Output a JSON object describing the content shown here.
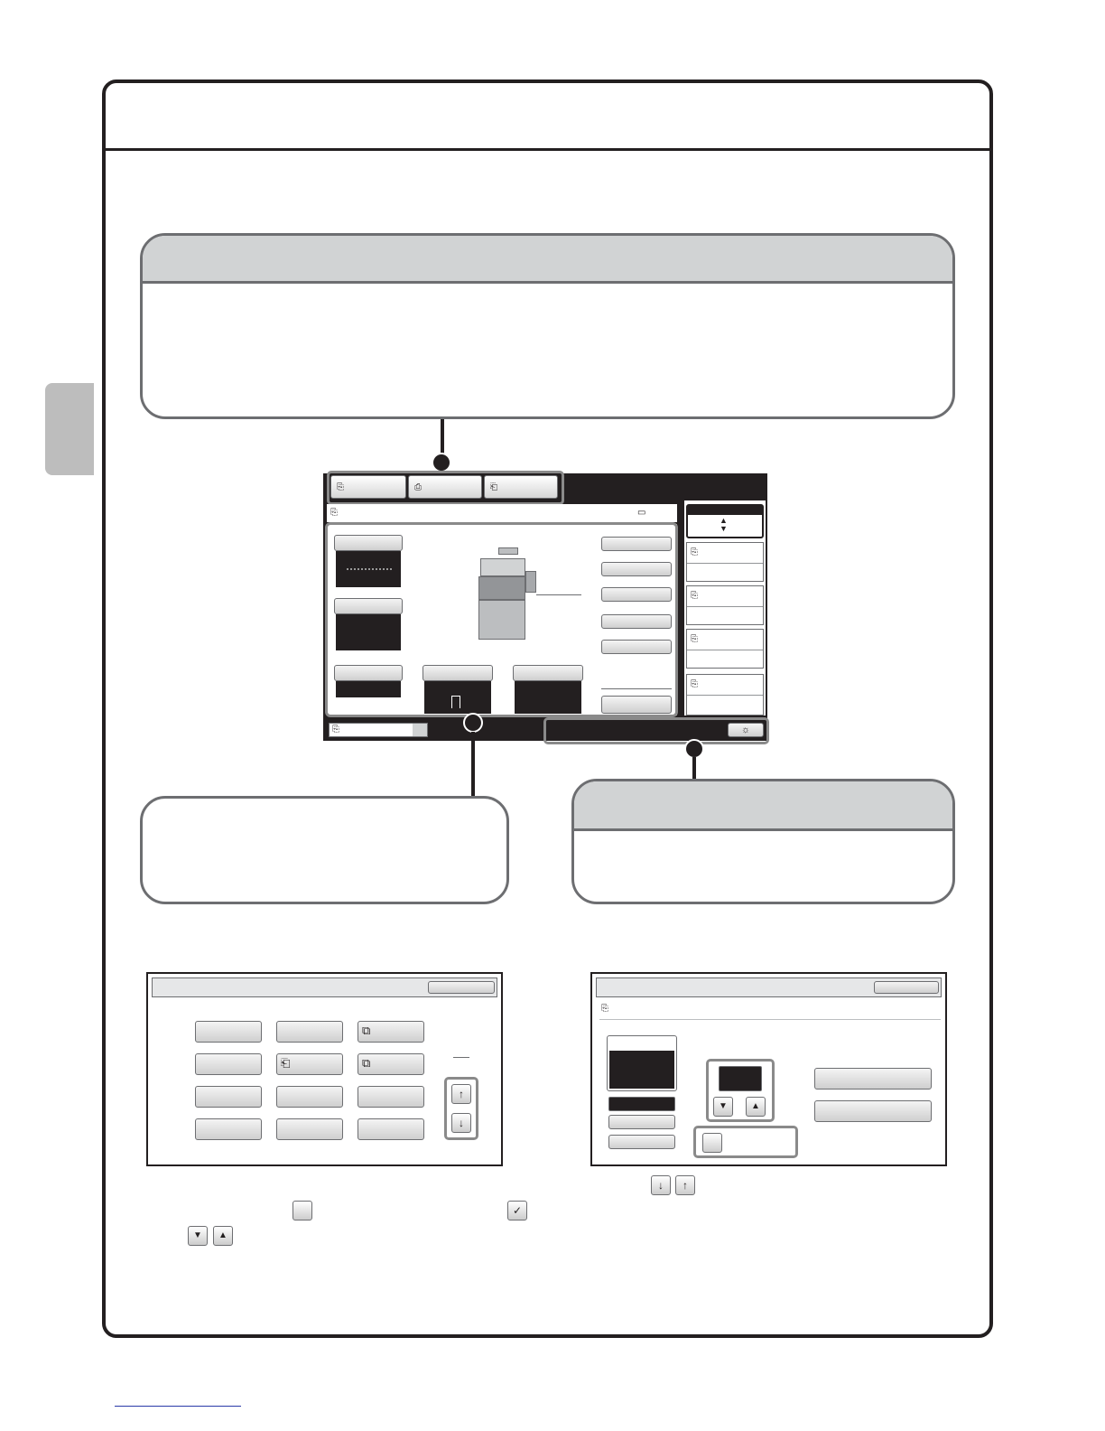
{
  "icons": {
    "screen_tab_icons": [
      "copy-mode-icon",
      "image-send-mode-icon",
      "document-filing-mode-icon"
    ],
    "arrow_glyphs": {
      "down": "▼",
      "up": "▲",
      "scroll_up": "🡅",
      "scroll_down": "🡇",
      "check": "✓"
    }
  },
  "colors": {
    "frame": "#231f20",
    "callout_header": "#d1d3d4",
    "callout_border": "#6d6e71",
    "side_tab": "#bdbdbd",
    "screen_bg": "#231f20"
  }
}
